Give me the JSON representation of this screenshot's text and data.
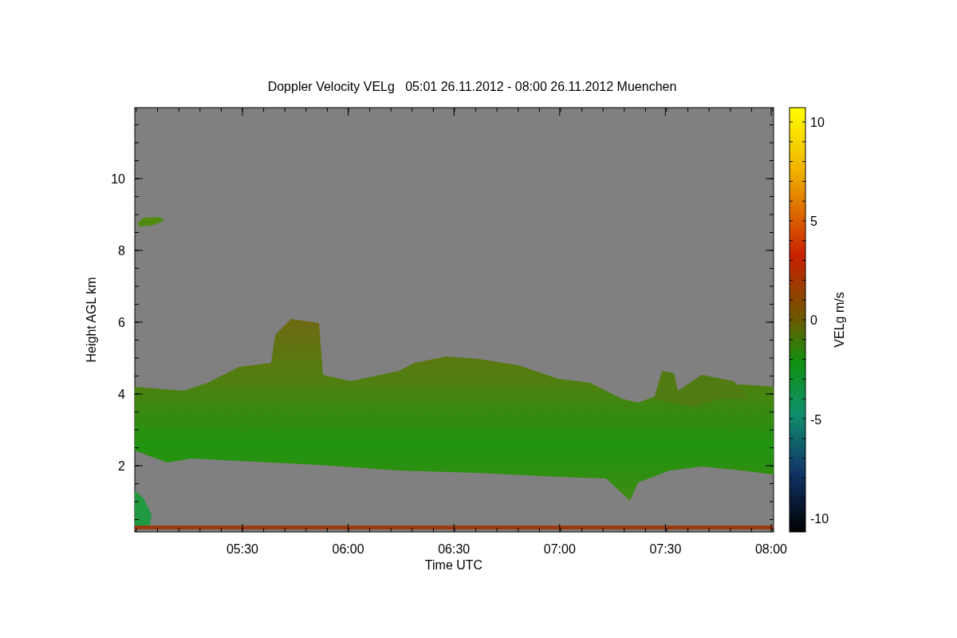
{
  "title": "Doppler Velocity VELg   05:01 26.11.2012 - 08:00 26.11.2012 Muenchen",
  "y_axis": {
    "label": "Height AGL km",
    "ticks": [
      "10",
      "8",
      "6",
      "4",
      "2"
    ]
  },
  "x_axis": {
    "label": "Time UTC",
    "ticks": [
      "05:30",
      "06:00",
      "06:30",
      "07:00",
      "07:30",
      "08:00"
    ]
  },
  "colorbar": {
    "label": "VELg m/s",
    "ticks": [
      "10",
      "5",
      "0",
      "-5",
      "-10"
    ]
  }
}
